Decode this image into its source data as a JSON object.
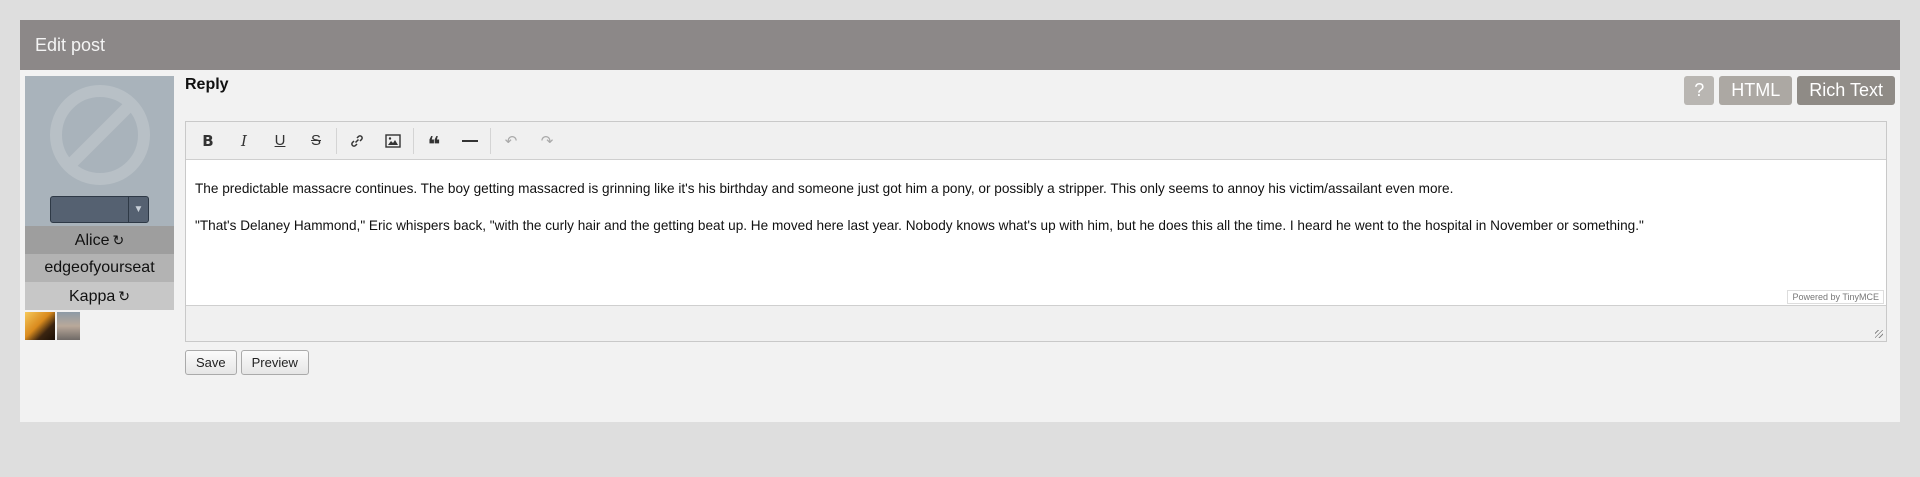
{
  "panel": {
    "title": "Edit post"
  },
  "user": {
    "name": "Alice",
    "handle": "edgeofyourseat",
    "group": "Kappa",
    "sync_icon": "sync-icon",
    "avatar_icon": "no-avatar-icon"
  },
  "reply": {
    "title": "Reply"
  },
  "mode_buttons": {
    "help": "?",
    "html": "HTML",
    "rich": "Rich Text"
  },
  "toolbar": {
    "items": [
      "bold-icon",
      "italic-icon",
      "underline-icon",
      "strikethrough-icon",
      "link-icon",
      "image-icon",
      "blockquote-icon",
      "horizontal-rule-icon",
      "undo-icon",
      "redo-icon"
    ]
  },
  "editor": {
    "paragraphs": [
      "The predictable massacre continues. The boy getting massacred is grinning like it's his birthday and someone just got him a pony, or possibly a stripper. This only seems to annoy his victim/assailant even more.",
      "\"That's Delaney Hammond,\" Eric whispers back, \"with the curly hair and the getting beat up. He moved here last year. Nobody knows what's up with him, but he does this all the time. I heard he went to the hospital in November or something.\""
    ],
    "powered_by": "Powered by TinyMCE"
  },
  "actions": {
    "save": "Save",
    "preview": "Preview"
  },
  "colors": {
    "header": "#8c8888",
    "panel": "#f2f2f2",
    "page": "#dedede"
  }
}
